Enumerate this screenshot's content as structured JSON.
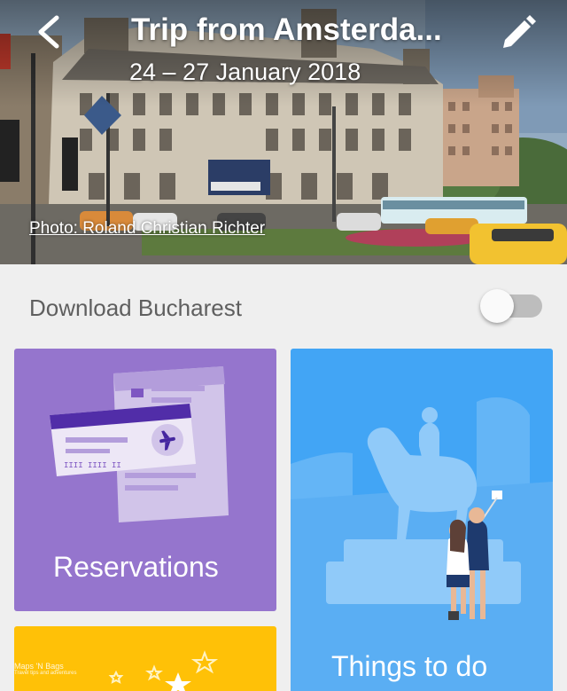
{
  "header": {
    "title": "Trip from Amsterda...",
    "dates": "24 – 27 January 2018",
    "photo_credit": "Photo: Roland Christian Richter"
  },
  "download": {
    "label": "Download Bucharest",
    "enabled": false
  },
  "cards": {
    "reservations": {
      "label": "Reservations"
    },
    "things_to_do": {
      "label": "Things to do"
    }
  },
  "watermark": {
    "name": "Maps 'N Bags",
    "tagline": "Travel tips and adventures"
  },
  "colors": {
    "reservations_card": "#9575cd",
    "things_to_do_card": "#42a5f5",
    "third_card": "#ffc107",
    "background": "#efefef"
  }
}
